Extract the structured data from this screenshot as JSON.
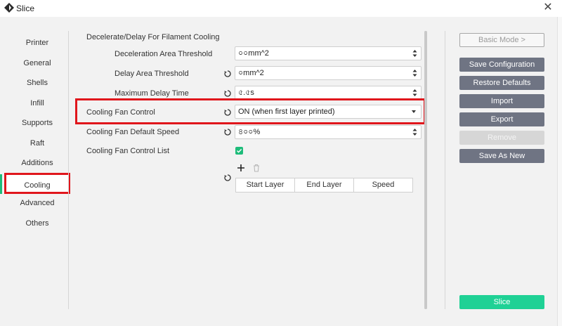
{
  "window": {
    "title": "Slice",
    "close_glyph": "✕"
  },
  "nav": {
    "items": [
      {
        "label": "Printer"
      },
      {
        "label": "General"
      },
      {
        "label": "Shells"
      },
      {
        "label": "Infill"
      },
      {
        "label": "Supports"
      },
      {
        "label": "Raft"
      },
      {
        "label": "Additions"
      },
      {
        "label": "Cooling"
      },
      {
        "label": "Advanced"
      },
      {
        "label": "Others"
      }
    ],
    "active": "Cooling"
  },
  "settings": {
    "section_title": "Decelerate/Delay For Filament Cooling",
    "deceleration_area": {
      "label": "Deceleration Area Threshold",
      "value": "০০mm^2"
    },
    "delay_area": {
      "label": "Delay Area Threshold",
      "value": "০mm^2"
    },
    "max_delay": {
      "label": "Maximum Delay Time",
      "value": "৫.৫s"
    },
    "fan_control": {
      "label": "Cooling Fan Control",
      "value": "ON (when first layer printed)"
    },
    "fan_default_speed": {
      "label": "Cooling Fan Default Speed",
      "value": "৪০০%"
    },
    "fan_control_list": {
      "label": "Cooling Fan Control List",
      "checked": true
    },
    "table_columns": [
      "Start Layer",
      "End Layer",
      "Speed"
    ]
  },
  "actions": {
    "basic_mode": "Basic Mode >",
    "save_config": "Save Configuration",
    "restore_defaults": "Restore Defaults",
    "import": "Import",
    "export": "Export",
    "remove": "Remove",
    "save_as_new": "Save As New",
    "slice": "Slice"
  },
  "colors": {
    "accent_green": "#1fd195",
    "highlight_red": "#e0161c",
    "button_gray": "#6f7483"
  },
  "icons": {
    "app": "slice-logo-icon",
    "reset": "reset-arrow-icon",
    "add": "plus-icon",
    "delete": "trash-icon"
  }
}
